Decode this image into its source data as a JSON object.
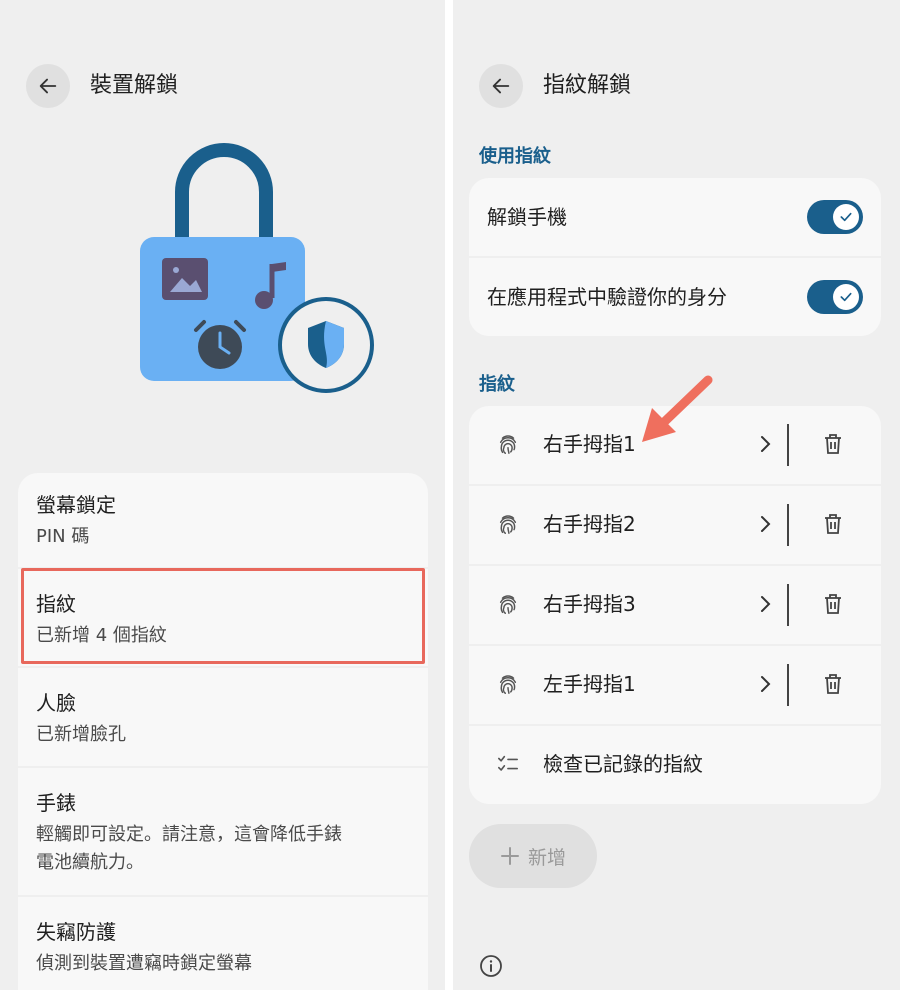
{
  "left": {
    "title": "裝置解鎖",
    "items": [
      {
        "title": "螢幕鎖定",
        "subtitle": "PIN 碼"
      },
      {
        "title": "指紋",
        "subtitle": "已新增 4 個指紋"
      },
      {
        "title": "人臉",
        "subtitle": "已新增臉孔"
      },
      {
        "title": "手錶",
        "subtitle": "輕觸即可設定。請注意，這會降低手錶",
        "subtitle2": "電池續航力。"
      },
      {
        "title": "失竊防護",
        "subtitle": "偵測到裝置遭竊時鎖定螢幕"
      }
    ]
  },
  "right": {
    "title": "指紋解鎖",
    "use_section": "使用指紋",
    "toggles": [
      {
        "label": "解鎖手機",
        "on": true
      },
      {
        "label": "在應用程式中驗證你的身分",
        "on": true
      }
    ],
    "fp_section": "指紋",
    "fingerprints": [
      "右手拇指1",
      "右手拇指2",
      "右手拇指3",
      "左手拇指1"
    ],
    "check_label": "檢查已記錄的指紋",
    "add_label": "新增"
  },
  "colors": {
    "accent": "#1a5f8c",
    "highlight": "#e8685c",
    "arrow": "#ef6f5e",
    "lock_body": "#6ab0f3",
    "lock_shackle": "#1a5f8c"
  }
}
